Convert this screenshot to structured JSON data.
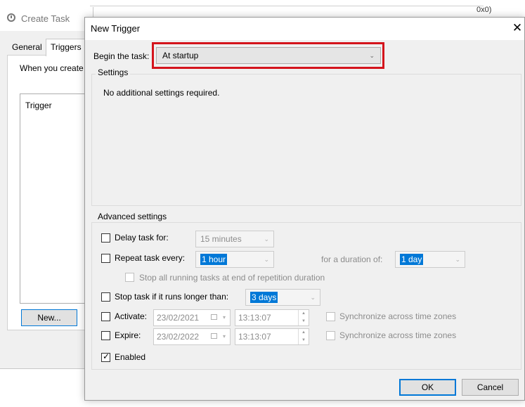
{
  "background_window": {
    "title": "Create Task",
    "tabs": [
      "General",
      "Triggers"
    ],
    "description": "When you create",
    "list_header": "Trigger",
    "new_button": "New...",
    "stray_text": "0x0)"
  },
  "dialog": {
    "title": "New Trigger",
    "close_glyph": "✕",
    "begin_label": "Begin the task:",
    "begin_value": "At startup",
    "settings_caption": "Settings",
    "settings_text": "No additional settings required.",
    "advanced_caption": "Advanced settings",
    "delay": {
      "label": "Delay task for:",
      "value": "15 minutes",
      "checked": false
    },
    "repeat": {
      "label": "Repeat task every:",
      "value": "1 hour",
      "duration_label": "for a duration of:",
      "duration_value": "1 day",
      "checked": false
    },
    "stop_running": {
      "label": "Stop all running tasks at end of repetition duration",
      "checked": false
    },
    "stop_longer": {
      "label": "Stop task if it runs longer than:",
      "value": "3 days",
      "checked": false
    },
    "activate": {
      "label": "Activate:",
      "date": "23/02/2021",
      "time": "13:13:07",
      "sync_label": "Synchronize across time zones",
      "checked": false
    },
    "expire": {
      "label": "Expire:",
      "date": "23/02/2022",
      "time": "13:13:07",
      "sync_label": "Synchronize across time zones",
      "checked": false
    },
    "enabled": {
      "label": "Enabled",
      "checked": true
    },
    "ok_button": "OK",
    "cancel_button": "Cancel"
  },
  "colors": {
    "highlight": "#d4141c",
    "accent": "#0078d7",
    "dialog_bg": "#f0f0f0"
  }
}
